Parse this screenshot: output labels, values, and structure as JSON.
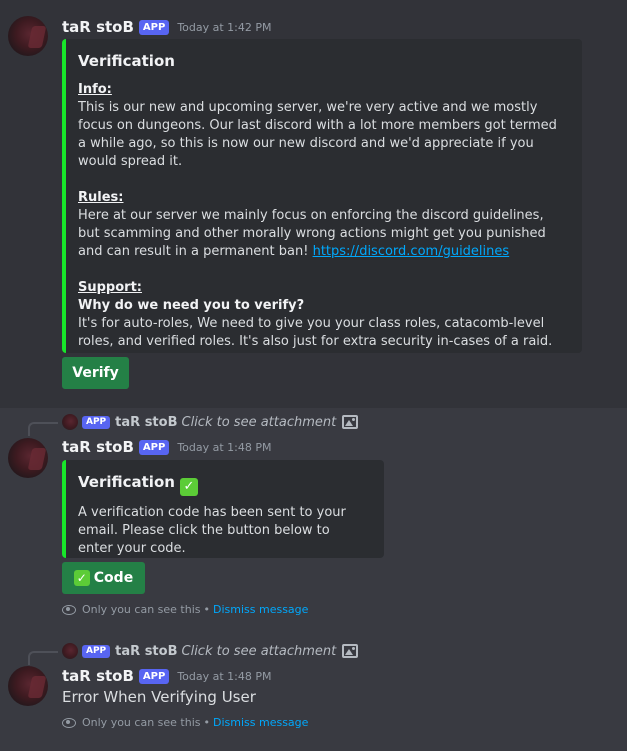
{
  "top_remnant": "...",
  "messages": [
    {
      "username": "taR stoB",
      "tag": "APP",
      "timestamp": "Today at 1:42 PM",
      "embed": {
        "title": "Verification",
        "info_heading": "Info:",
        "info_text": "This is our new and upcoming server, we're very active and we mostly focus on dungeons. Our last discord with a lot more members got termed a while ago, so this is now our new discord and we'd appreciate if you would spread it.",
        "rules_heading": "Rules:",
        "rules_text": "Here at our server we mainly focus on enforcing the discord guidelines, but scamming and other morally wrong actions might get you punished and can result in a permanent ban!",
        "rules_link": "https://discord.com/guidelines",
        "support_heading": "Support:",
        "support_question": "Why do we need you to verify?",
        "support_text": "It's for auto-roles, We need to give you your class roles, catacomb-level roles, and verified roles. It's also just for extra security in-cases of a raid."
      },
      "button_label": "Verify"
    },
    {
      "reply": {
        "username": "taR stoB",
        "tag": "APP",
        "text": "Click to see attachment"
      },
      "username": "taR stoB",
      "tag": "APP",
      "timestamp": "Today at 1:48 PM",
      "embed": {
        "title": "Verification",
        "text": "A verification code has been sent to your email. Please click the button below to enter your code."
      },
      "button_label": "Code",
      "ephemeral": {
        "text": "Only you can see this",
        "separator": "•",
        "dismiss": "Dismiss message"
      }
    },
    {
      "reply": {
        "username": "taR stoB",
        "tag": "APP",
        "text": "Click to see attachment"
      },
      "username": "taR stoB",
      "tag": "APP",
      "timestamp": "Today at 1:48 PM",
      "content": "Error When Verifying User",
      "ephemeral": {
        "text": "Only you can see this",
        "separator": "•",
        "dismiss": "Dismiss message"
      }
    }
  ],
  "colors": {
    "accent_green": "#18e62a",
    "button_green": "#248046",
    "link_blue": "#00a8fc",
    "app_tag": "#5865f2"
  }
}
